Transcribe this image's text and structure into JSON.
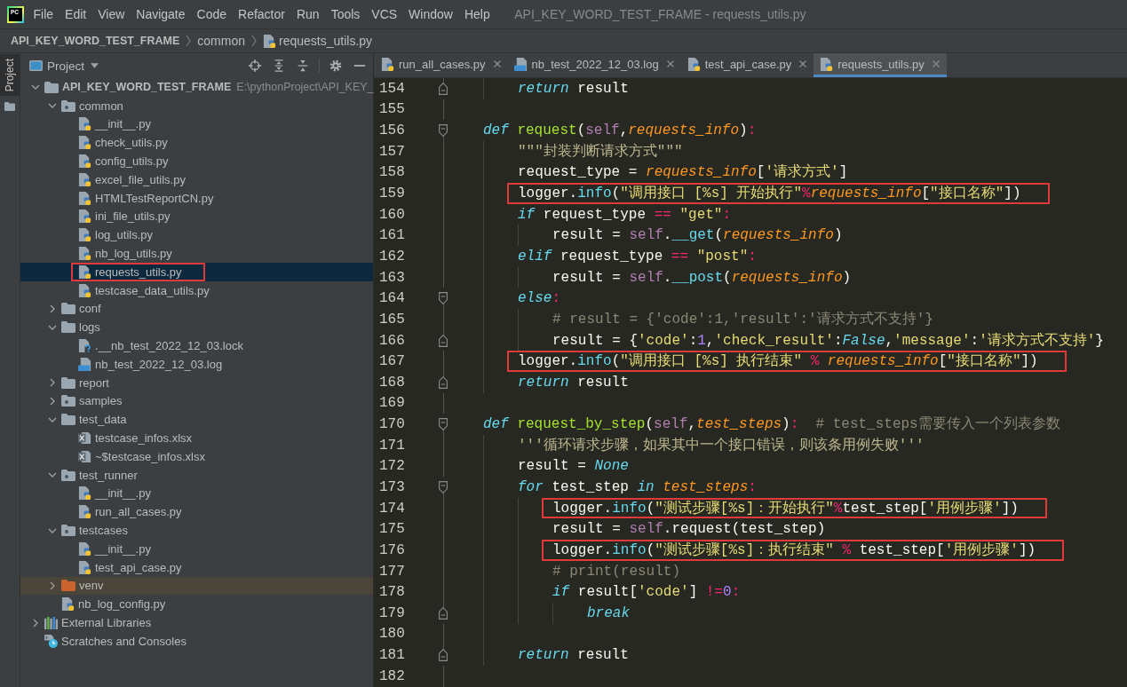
{
  "menu_bar": {
    "logo": "PC",
    "items": [
      "File",
      "Edit",
      "View",
      "Navigate",
      "Code",
      "Refactor",
      "Run",
      "Tools",
      "VCS",
      "Window",
      "Help"
    ],
    "title": "API_KEY_WORD_TEST_FRAME - requests_utils.py"
  },
  "breadcrumbs": [
    {
      "label": "API_KEY_WORD_TEST_FRAME",
      "kind": "project"
    },
    {
      "label": "common",
      "kind": "folder"
    },
    {
      "label": "requests_utils.py",
      "kind": "python"
    }
  ],
  "tool_strip": {
    "tabs": [
      {
        "label": "Project",
        "selected": true
      }
    ]
  },
  "project_panel": {
    "title": "Project",
    "tree": [
      {
        "label": "API_KEY_WORD_TEST_FRAME",
        "kind": "project",
        "path": "E:\\pythonProject\\API_KEY_",
        "expanded": true,
        "selected": false,
        "boxed": false,
        "children": [
          {
            "label": "common",
            "kind": "package",
            "expanded": true,
            "selected": false,
            "boxed": false,
            "children": [
              {
                "label": "__init__.py",
                "kind": "python",
                "selected": false,
                "boxed": false
              },
              {
                "label": "check_utils.py",
                "kind": "python",
                "selected": false,
                "boxed": false
              },
              {
                "label": "config_utils.py",
                "kind": "python",
                "selected": false,
                "boxed": false
              },
              {
                "label": "excel_file_utils.py",
                "kind": "python",
                "selected": false,
                "boxed": false
              },
              {
                "label": "HTMLTestReportCN.py",
                "kind": "python",
                "selected": false,
                "boxed": false
              },
              {
                "label": "ini_file_utils.py",
                "kind": "python",
                "selected": false,
                "boxed": false
              },
              {
                "label": "log_utils.py",
                "kind": "python",
                "selected": false,
                "boxed": false
              },
              {
                "label": "nb_log_utils.py",
                "kind": "python",
                "selected": false,
                "boxed": false
              },
              {
                "label": "requests_utils.py",
                "kind": "python",
                "selected": true,
                "boxed": true
              },
              {
                "label": "testcase_data_utils.py",
                "kind": "python",
                "selected": false,
                "boxed": false
              }
            ]
          },
          {
            "label": "conf",
            "kind": "folder",
            "expanded": false,
            "selected": false,
            "boxed": false
          },
          {
            "label": "logs",
            "kind": "folder",
            "expanded": true,
            "selected": false,
            "boxed": false,
            "children": [
              {
                "label": ".__nb_test_2022_12_03.lock",
                "kind": "unknown",
                "selected": false,
                "boxed": false
              },
              {
                "label": "nb_test_2022_12_03.log",
                "kind": "log",
                "selected": false,
                "boxed": false
              }
            ]
          },
          {
            "label": "report",
            "kind": "folder",
            "expanded": false,
            "selected": false,
            "boxed": false
          },
          {
            "label": "samples",
            "kind": "package",
            "expanded": false,
            "selected": false,
            "boxed": false
          },
          {
            "label": "test_data",
            "kind": "folder",
            "expanded": true,
            "selected": false,
            "boxed": false,
            "children": [
              {
                "label": "testcase_infos.xlsx",
                "kind": "excel",
                "selected": false,
                "boxed": false
              },
              {
                "label": "~$testcase_infos.xlsx",
                "kind": "excel",
                "selected": false,
                "boxed": false
              }
            ]
          },
          {
            "label": "test_runner",
            "kind": "package",
            "expanded": true,
            "selected": false,
            "boxed": false,
            "children": [
              {
                "label": "__init__.py",
                "kind": "python",
                "selected": false,
                "boxed": false
              },
              {
                "label": "run_all_cases.py",
                "kind": "python",
                "selected": false,
                "boxed": false
              }
            ]
          },
          {
            "label": "testcases",
            "kind": "package",
            "expanded": true,
            "selected": false,
            "boxed": false,
            "children": [
              {
                "label": "__init__.py",
                "kind": "python",
                "selected": false,
                "boxed": false
              },
              {
                "label": "test_api_case.py",
                "kind": "python",
                "selected": false,
                "boxed": false
              }
            ]
          },
          {
            "label": "venv",
            "kind": "excluded",
            "expanded": false,
            "selected": false,
            "boxed": false
          },
          {
            "label": "nb_log_config.py",
            "kind": "python",
            "selected": false,
            "boxed": false
          }
        ]
      },
      {
        "label": "External Libraries",
        "kind": "libraries",
        "expanded": false,
        "selected": false,
        "boxed": false
      },
      {
        "label": "Scratches and Consoles",
        "kind": "scratches",
        "selected": false,
        "boxed": false
      }
    ]
  },
  "editor": {
    "tabs": [
      {
        "label": "run_all_cases.py",
        "kind": "python",
        "selected": false
      },
      {
        "label": "nb_test_2022_12_03.log",
        "kind": "log",
        "selected": false
      },
      {
        "label": "test_api_case.py",
        "kind": "python",
        "selected": false
      },
      {
        "label": "requests_utils.py",
        "kind": "python",
        "selected": true
      }
    ],
    "lines": [
      {
        "children": [
          {
            "number": "154",
            "fold_start": false,
            "fold_end": true,
            "boxed": false,
            "tokens": [
              {
                "kind": "keyword",
                "text": "return"
              },
              {
                "kind": "text",
                "text": " result"
              }
            ]
          }
        ]
      },
      {
        "number": "155",
        "fold_start": false,
        "fold_end": false
      },
      {
        "number": "156",
        "fold_start": true,
        "fold_end": false,
        "boxed": false,
        "tokens": [
          {
            "kind": "keyword",
            "text": "def"
          },
          {
            "kind": "function",
            "text": " request"
          },
          {
            "kind": "text",
            "text": "("
          },
          {
            "kind": "self",
            "text": "self"
          },
          {
            "kind": "text",
            "text": ","
          },
          {
            "kind": "parameter",
            "text": "requests_info"
          },
          {
            "kind": "text",
            "text": ")"
          },
          {
            "kind": "operator",
            "text": ":"
          }
        ],
        "children": [
          {
            "number": "157",
            "fold_start": false,
            "fold_end": false,
            "boxed": false,
            "tokens": [
              {
                "kind": "docstring",
                "text": "\"\"\"封装判断请求方式\"\"\""
              }
            ]
          },
          {
            "number": "158",
            "fold_start": false,
            "fold_end": false,
            "boxed": false,
            "tokens": [
              {
                "kind": "text",
                "text": "request_type = "
              },
              {
                "kind": "parameter",
                "text": "requests_info"
              },
              {
                "kind": "text",
                "text": "["
              },
              {
                "kind": "string",
                "text": "'请求方式'"
              },
              {
                "kind": "text",
                "text": "]"
              }
            ]
          },
          {
            "number": "159",
            "fold_start": false,
            "fold_end": false,
            "boxed": true,
            "tokens": [
              {
                "kind": "text",
                "text": "logger."
              },
              {
                "kind": "call",
                "text": "info"
              },
              {
                "kind": "text",
                "text": "("
              },
              {
                "kind": "string",
                "text": "\"调用接口 [%s] 开始执行\""
              },
              {
                "kind": "operator",
                "text": "%"
              },
              {
                "kind": "parameter",
                "text": "requests_info"
              },
              {
                "kind": "text",
                "text": "["
              },
              {
                "kind": "string",
                "text": "\"接口名称\""
              },
              {
                "kind": "text",
                "text": "])"
              }
            ]
          },
          {
            "number": "160",
            "fold_start": false,
            "fold_end": false,
            "boxed": false,
            "tokens": [
              {
                "kind": "keyword",
                "text": "if"
              },
              {
                "kind": "text",
                "text": " request_type "
              },
              {
                "kind": "operator",
                "text": "=="
              },
              {
                "kind": "string",
                "text": " \"get\""
              },
              {
                "kind": "operator",
                "text": ":"
              }
            ],
            "children": [
              {
                "number": "161",
                "fold_start": false,
                "fold_end": false,
                "boxed": false,
                "tokens": [
                  {
                    "kind": "text",
                    "text": "result = "
                  },
                  {
                    "kind": "self",
                    "text": "self"
                  },
                  {
                    "kind": "text",
                    "text": "."
                  },
                  {
                    "kind": "call",
                    "text": "__get"
                  },
                  {
                    "kind": "text",
                    "text": "("
                  },
                  {
                    "kind": "parameter",
                    "text": "requests_info"
                  },
                  {
                    "kind": "text",
                    "text": ")"
                  }
                ]
              }
            ]
          },
          {
            "number": "162",
            "fold_start": false,
            "fold_end": false,
            "boxed": false,
            "tokens": [
              {
                "kind": "keyword",
                "text": "elif"
              },
              {
                "kind": "text",
                "text": " request_type "
              },
              {
                "kind": "operator",
                "text": "=="
              },
              {
                "kind": "string",
                "text": " \"post\""
              },
              {
                "kind": "operator",
                "text": ":"
              }
            ],
            "children": [
              {
                "number": "163",
                "fold_start": false,
                "fold_end": false,
                "boxed": false,
                "tokens": [
                  {
                    "kind": "text",
                    "text": "result = "
                  },
                  {
                    "kind": "self",
                    "text": "self"
                  },
                  {
                    "kind": "text",
                    "text": "."
                  },
                  {
                    "kind": "call",
                    "text": "__post"
                  },
                  {
                    "kind": "text",
                    "text": "("
                  },
                  {
                    "kind": "parameter",
                    "text": "requests_info"
                  },
                  {
                    "kind": "text",
                    "text": ")"
                  }
                ]
              }
            ]
          },
          {
            "number": "164",
            "fold_start": true,
            "fold_end": false,
            "boxed": false,
            "tokens": [
              {
                "kind": "keyword",
                "text": "else"
              },
              {
                "kind": "operator",
                "text": ":"
              }
            ],
            "children": [
              {
                "number": "165",
                "fold_start": false,
                "fold_end": false,
                "boxed": false,
                "tokens": [
                  {
                    "kind": "comment",
                    "text": "# result = {'code':1,'result':'请求方式不支持'}"
                  }
                ]
              },
              {
                "number": "166",
                "fold_start": false,
                "fold_end": true,
                "boxed": false,
                "tokens": [
                  {
                    "kind": "text",
                    "text": "result = {"
                  },
                  {
                    "kind": "string",
                    "text": "'code'"
                  },
                  {
                    "kind": "text",
                    "text": ":"
                  },
                  {
                    "kind": "number",
                    "text": "1"
                  },
                  {
                    "kind": "text",
                    "text": ","
                  },
                  {
                    "kind": "string",
                    "text": "'check_result'"
                  },
                  {
                    "kind": "text",
                    "text": ":"
                  },
                  {
                    "kind": "keyword",
                    "text": "False"
                  },
                  {
                    "kind": "text",
                    "text": ","
                  },
                  {
                    "kind": "string",
                    "text": "'message'"
                  },
                  {
                    "kind": "text",
                    "text": ":"
                  },
                  {
                    "kind": "string",
                    "text": "'请求方式不支持'"
                  },
                  {
                    "kind": "text",
                    "text": "}"
                  }
                ]
              }
            ]
          },
          {
            "number": "167",
            "fold_start": false,
            "fold_end": false,
            "boxed": true,
            "tokens": [
              {
                "kind": "text",
                "text": "logger."
              },
              {
                "kind": "call",
                "text": "info"
              },
              {
                "kind": "text",
                "text": "("
              },
              {
                "kind": "string",
                "text": "\"调用接口 [%s] 执行结束\""
              },
              {
                "kind": "operator",
                "text": " % "
              },
              {
                "kind": "parameter",
                "text": "requests_info"
              },
              {
                "kind": "text",
                "text": "["
              },
              {
                "kind": "string",
                "text": "\"接口名称\""
              },
              {
                "kind": "text",
                "text": "])"
              }
            ]
          },
          {
            "number": "168",
            "fold_start": false,
            "fold_end": true,
            "boxed": false,
            "tokens": [
              {
                "kind": "keyword",
                "text": "return"
              },
              {
                "kind": "text",
                "text": " result"
              }
            ]
          }
        ]
      },
      {
        "number": "169",
        "fold_start": false,
        "fold_end": false
      },
      {
        "number": "170",
        "fold_start": true,
        "fold_end": false,
        "boxed": false,
        "tokens": [
          {
            "kind": "keyword",
            "text": "def"
          },
          {
            "kind": "function",
            "text": " request_by_step"
          },
          {
            "kind": "text",
            "text": "("
          },
          {
            "kind": "self",
            "text": "self"
          },
          {
            "kind": "text",
            "text": ","
          },
          {
            "kind": "parameter",
            "text": "test_steps"
          },
          {
            "kind": "text",
            "text": ")"
          },
          {
            "kind": "operator",
            "text": ":"
          },
          {
            "kind": "comment",
            "text": "  # test_steps需要传入一个列表参数"
          }
        ],
        "children": [
          {
            "number": "171",
            "fold_start": false,
            "fold_end": false,
            "boxed": false,
            "tokens": [
              {
                "kind": "docstring",
                "text": "'''循环请求步骤，如果其中一个接口错误，则该条用例失败'''"
              }
            ]
          },
          {
            "number": "172",
            "fold_start": false,
            "fold_end": false,
            "boxed": false,
            "tokens": [
              {
                "kind": "text",
                "text": "result = "
              },
              {
                "kind": "keyword",
                "text": "None"
              }
            ]
          },
          {
            "number": "173",
            "fold_start": true,
            "fold_end": false,
            "boxed": false,
            "tokens": [
              {
                "kind": "keyword",
                "text": "for"
              },
              {
                "kind": "text",
                "text": " test_step "
              },
              {
                "kind": "keyword",
                "text": "in"
              },
              {
                "kind": "parameter",
                "text": " test_steps"
              },
              {
                "kind": "operator",
                "text": ":"
              }
            ],
            "children": [
              {
                "number": "174",
                "fold_start": false,
                "fold_end": false,
                "boxed": true,
                "tokens": [
                  {
                    "kind": "text",
                    "text": "logger."
                  },
                  {
                    "kind": "call",
                    "text": "info"
                  },
                  {
                    "kind": "text",
                    "text": "("
                  },
                  {
                    "kind": "string",
                    "text": "\"测试步骤[%s]：开始执行\""
                  },
                  {
                    "kind": "operator",
                    "text": "%"
                  },
                  {
                    "kind": "text",
                    "text": "test_step["
                  },
                  {
                    "kind": "string",
                    "text": "'用例步骤'"
                  },
                  {
                    "kind": "text",
                    "text": "])"
                  }
                ]
              },
              {
                "number": "175",
                "fold_start": false,
                "fold_end": false,
                "boxed": false,
                "tokens": [
                  {
                    "kind": "text",
                    "text": "result = "
                  },
                  {
                    "kind": "self",
                    "text": "self"
                  },
                  {
                    "kind": "text",
                    "text": ".request(test_step)"
                  }
                ]
              },
              {
                "number": "176",
                "fold_start": false,
                "fold_end": false,
                "boxed": true,
                "tokens": [
                  {
                    "kind": "text",
                    "text": "logger."
                  },
                  {
                    "kind": "call",
                    "text": "info"
                  },
                  {
                    "kind": "text",
                    "text": "("
                  },
                  {
                    "kind": "string",
                    "text": "\"测试步骤[%s]：执行结束\""
                  },
                  {
                    "kind": "operator",
                    "text": " %"
                  },
                  {
                    "kind": "text",
                    "text": " test_step["
                  },
                  {
                    "kind": "string",
                    "text": "'用例步骤'"
                  },
                  {
                    "kind": "text",
                    "text": "])"
                  }
                ]
              },
              {
                "number": "177",
                "fold_start": false,
                "fold_end": false,
                "boxed": false,
                "tokens": [
                  {
                    "kind": "comment",
                    "text": "# print(result)"
                  }
                ]
              },
              {
                "number": "178",
                "fold_start": false,
                "fold_end": false,
                "boxed": false,
                "tokens": [
                  {
                    "kind": "keyword",
                    "text": "if"
                  },
                  {
                    "kind": "text",
                    "text": " result["
                  },
                  {
                    "kind": "string",
                    "text": "'code'"
                  },
                  {
                    "kind": "text",
                    "text": "] "
                  },
                  {
                    "kind": "operator",
                    "text": "!="
                  },
                  {
                    "kind": "number",
                    "text": "0"
                  },
                  {
                    "kind": "operator",
                    "text": ":"
                  }
                ],
                "children": [
                  {
                    "number": "179",
                    "fold_start": false,
                    "fold_end": true,
                    "boxed": false,
                    "tokens": [
                      {
                        "kind": "keyword",
                        "text": "break"
                      }
                    ]
                  }
                ]
              }
            ]
          },
          {
            "number": "180",
            "fold_start": false,
            "fold_end": false
          },
          {
            "number": "181",
            "fold_start": false,
            "fold_end": true,
            "boxed": false,
            "tokens": [
              {
                "kind": "keyword",
                "text": "return"
              },
              {
                "kind": "text",
                "text": " result"
              }
            ]
          }
        ]
      },
      {
        "number": "182",
        "fold_start": false,
        "fold_end": false
      }
    ]
  }
}
